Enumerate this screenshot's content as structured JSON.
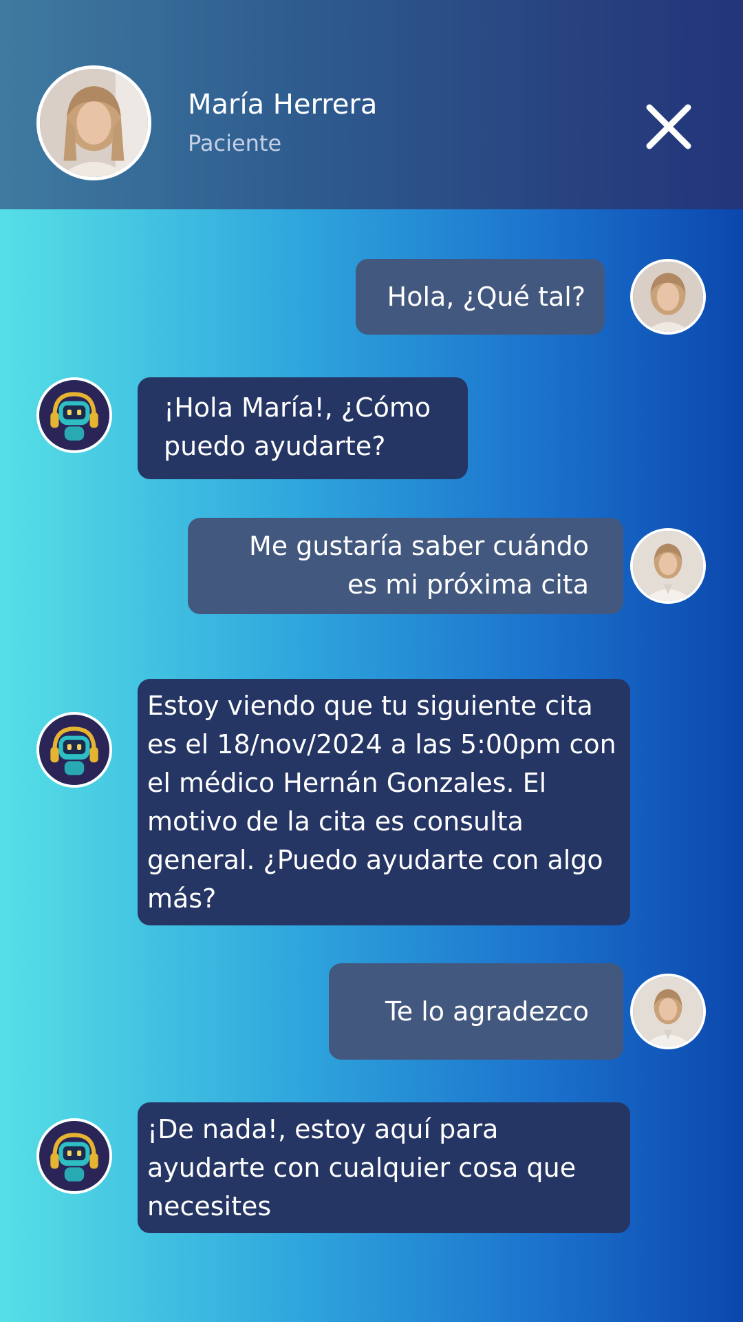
{
  "header": {
    "name": "María Herrera",
    "role": "Paciente"
  },
  "messages": [
    {
      "sender": "user",
      "text": "Hola, ¿Qué tal?"
    },
    {
      "sender": "bot",
      "text": "¡Hola María!, ¿Cómo puedo ayudarte?"
    },
    {
      "sender": "user",
      "text": "Me gustaría saber cuándo es mi próxima cita"
    },
    {
      "sender": "bot",
      "text": "Estoy viendo que tu siguiente cita es el 18/nov/2024 a las 5:00pm con el médico Hernán Gonzales. El motivo de la cita es consulta general. ¿Puedo ayudarte con algo más?"
    },
    {
      "sender": "user",
      "text": "Te lo agradezco"
    },
    {
      "sender": "bot",
      "text": "¡De nada!, estoy aquí para ayudarte con cualquier cosa que necesites"
    }
  ],
  "icons": {
    "close": "close-icon",
    "user_avatar": "user-avatar-photo",
    "bot_avatar": "robot-assistant-icon"
  },
  "colors": {
    "header_bg": "#2e4a86",
    "user_bubble": "#43587e",
    "bot_bubble": "#253564",
    "accent_light": "#56dfe6",
    "accent_dark": "#0b47ad"
  }
}
